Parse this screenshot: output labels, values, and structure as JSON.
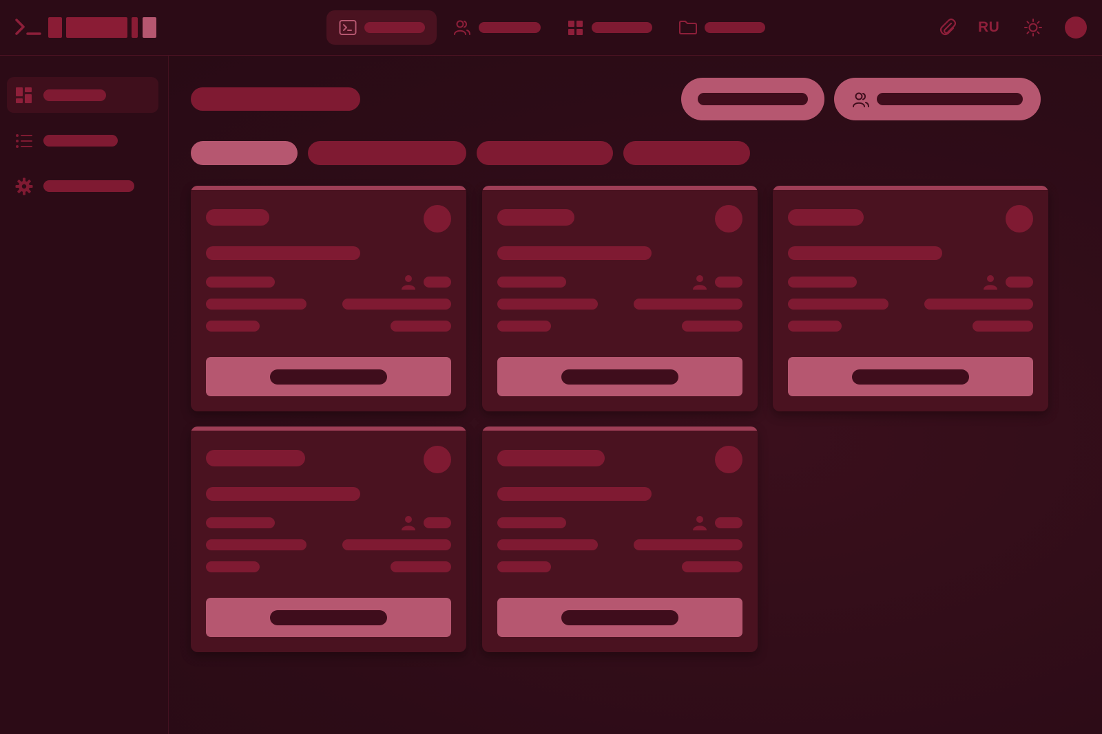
{
  "app": {
    "logo_icon": "terminal-prompt-icon"
  },
  "header": {
    "nav": [
      {
        "icon": "terminal-icon",
        "active": true
      },
      {
        "icon": "users-icon",
        "active": false
      },
      {
        "icon": "grid-icon",
        "active": false
      },
      {
        "icon": "folder-icon",
        "active": false
      }
    ],
    "attach_icon": "paperclip-icon",
    "language": "RU",
    "theme_icon": "sun-icon",
    "avatar_icon": "avatar"
  },
  "sidebar": {
    "items": [
      {
        "icon": "dashboard-icon",
        "active": true
      },
      {
        "icon": "list-icon",
        "active": false
      },
      {
        "icon": "gear-icon",
        "active": false
      }
    ]
  },
  "main": {
    "actions": [
      {
        "icon": null
      },
      {
        "icon": "users-icon"
      }
    ],
    "tabs_count": 4,
    "active_tab": 0,
    "cards_count": 5
  },
  "colors": {
    "background": "#2d0c17",
    "accent": "#7f1a32",
    "accent_light": "#b65770",
    "card": "#4a1220",
    "text_dim": "#8e1f3a"
  }
}
